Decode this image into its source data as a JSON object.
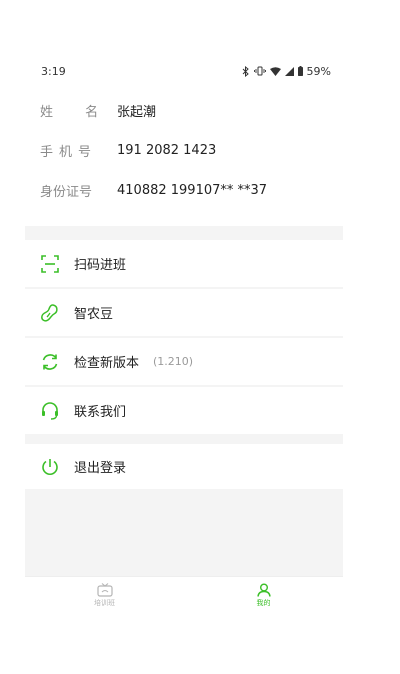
{
  "status_bar": {
    "time": "3:19",
    "battery": "59%"
  },
  "profile": {
    "name_label": "姓 名",
    "name_value": "张起潮",
    "phone_label": "手机号",
    "phone_value": "191 2082 1423",
    "id_label": "身份证号",
    "id_value": "410882 199107** **37"
  },
  "menu": {
    "scan": "扫码进班",
    "beans": "智农豆",
    "update": "检查新版本",
    "version": "(1.210)",
    "contact": "联系我们",
    "logout": "退出登录"
  },
  "tabs": {
    "training": "培训班",
    "mine": "我的"
  },
  "colors": {
    "accent": "#3bbf28",
    "label_gray": "#8a8a8a",
    "bg": "#f4f4f4"
  },
  "icons": [
    "bluetooth-icon",
    "vibrate-icon",
    "wifi-icon",
    "signal-icon",
    "battery-icon",
    "scan-icon",
    "bean-icon",
    "refresh-icon",
    "headset-icon",
    "power-icon",
    "tv-icon",
    "person-icon"
  ]
}
